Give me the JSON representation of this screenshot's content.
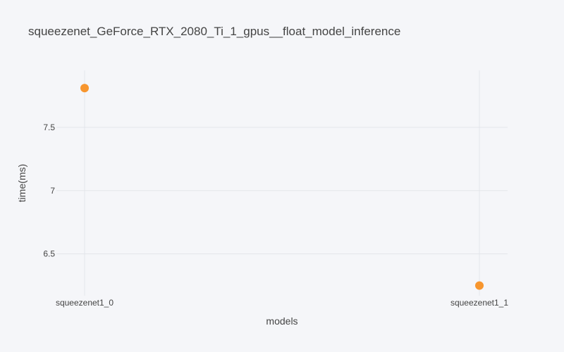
{
  "chart_data": {
    "type": "scatter",
    "title": "squeezenet_GeForce_RTX_2080_Ti_1_gpus__float_model_inference",
    "xlabel": "models",
    "ylabel": "time(ms)",
    "categories": [
      "squeezenet1_0",
      "squeezenet1_1"
    ],
    "series": [
      {
        "values": [
          7.81,
          6.25
        ],
        "color": "#f7962f"
      }
    ],
    "yticks": [
      6.5,
      7,
      7.5
    ],
    "ytick_labels": [
      "6.5",
      "7",
      "7.5"
    ],
    "ylim": [
      6.17,
      7.95
    ],
    "grid": true,
    "legend": "none"
  }
}
